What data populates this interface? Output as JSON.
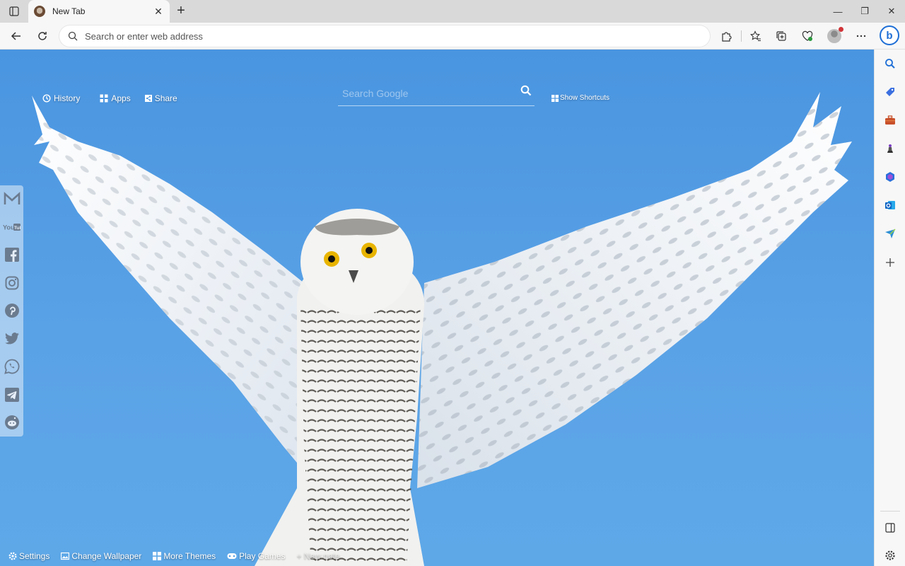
{
  "browser": {
    "tab": {
      "title": "New Tab"
    },
    "address_bar": {
      "placeholder": "Search or enter web address"
    }
  },
  "newtab": {
    "topnav": {
      "history": "History",
      "apps": "Apps",
      "share": "Share"
    },
    "search": {
      "placeholder": "Search Google"
    },
    "show_shortcuts": "Show Shortcuts",
    "social": [
      "gmail-icon",
      "youtube-icon",
      "facebook-icon",
      "instagram-icon",
      "pinterest-icon",
      "twitter-icon",
      "whatsapp-icon",
      "telegram-icon",
      "reddit-icon"
    ],
    "bottom": {
      "settings": "Settings",
      "change_wallpaper": "Change Wallpaper",
      "more_themes": "More Themes",
      "play_games": "Play Games",
      "new_note": "+ New note"
    }
  },
  "sidebar": {
    "icons": [
      "search-icon",
      "tag-icon",
      "briefcase-icon",
      "chess-icon",
      "office-icon",
      "outlook-icon",
      "send-icon",
      "add-icon",
      "split-screen-icon",
      "settings-icon"
    ]
  },
  "colors": {
    "sky": "#5aa2e6",
    "edge_blue": "#1f6fd6",
    "owl_eye": "#e8b400"
  }
}
